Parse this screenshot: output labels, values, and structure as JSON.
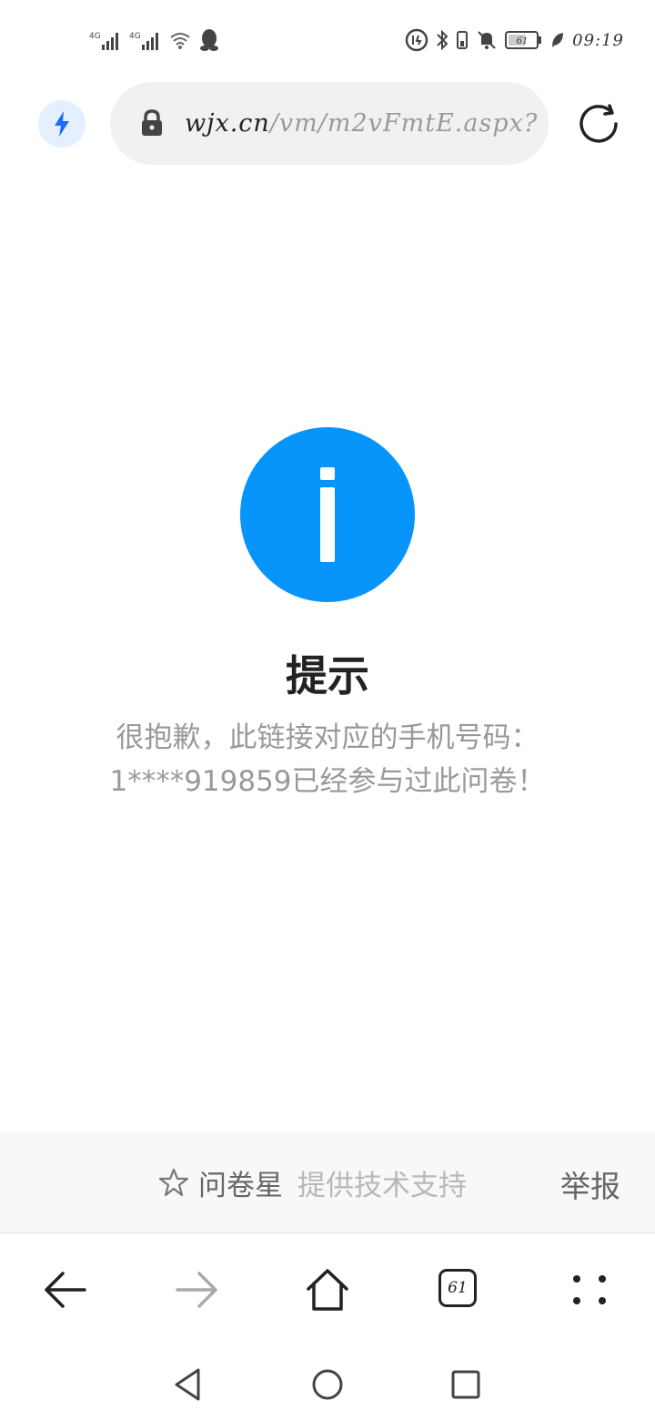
{
  "status_bar": {
    "signal1_label": "4G",
    "signal2_label": "4G",
    "battery_level": "61",
    "time": "09:19"
  },
  "address_bar": {
    "domain": "wjx.cn",
    "path": "/vm/m2vFmtE.aspx?"
  },
  "content": {
    "title": "提示",
    "message": "很抱歉，此链接对应的手机号码：1****919859已经参与过此问卷！"
  },
  "footer": {
    "brand_name": "问卷星",
    "support_text": "提供技术支持",
    "report_label": "举报"
  },
  "browser_nav": {
    "tab_count": "61"
  },
  "colors": {
    "info_blue": "#0794fb",
    "accent_blue": "#1a6cff"
  }
}
